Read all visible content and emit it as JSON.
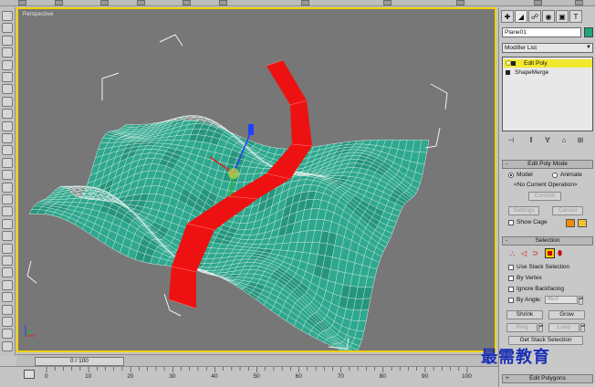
{
  "viewport": {
    "label": "Perspective"
  },
  "panel": {
    "object_name": "Plane01",
    "object_color": "#1ea37e",
    "modifier_list": "Modifier List",
    "stack": [
      {
        "label": "Edit Poly",
        "selected": true
      },
      {
        "label": "ShapeMerge",
        "selected": false
      }
    ],
    "edit_poly_mode": {
      "title": "Edit Poly Mode",
      "model": "Model",
      "animate": "Animate",
      "current_op": "<No Current Operation>",
      "commit": "Commit",
      "settings": "Settings",
      "cancel": "Cancel",
      "show_cage": "Show Cage"
    },
    "selection": {
      "title": "Selection",
      "use_stack": "Use Stack Selection",
      "by_vertex": "By Vertex",
      "ignore_backfacing": "Ignore Backfacing",
      "by_angle": "By Angle:",
      "angle_value": "45.0",
      "shrink": "Shrink",
      "grow": "Grow",
      "ring": "Ring",
      "loop": "Loop",
      "get_stack": "Get Stack Selection"
    },
    "edit_polygons": "Edit Polygons"
  },
  "timeline": {
    "slider": "0 / 100",
    "ticks": [
      "0",
      "10",
      "20",
      "30",
      "40",
      "50",
      "60",
      "70",
      "80",
      "90",
      "100"
    ]
  },
  "watermark": "最需教育",
  "colors": {
    "terrain": "#2ea88e",
    "wire": "#e8f4f0",
    "path": "#ee1111",
    "highlight": "#f0d000"
  }
}
